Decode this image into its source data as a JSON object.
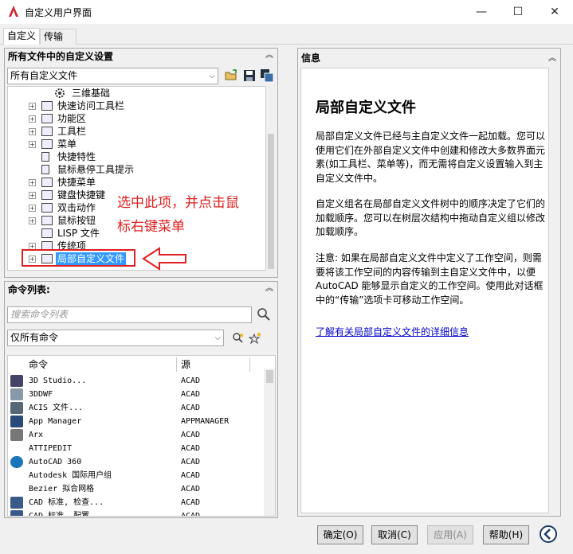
{
  "window": {
    "title": "自定义用户界面",
    "min_glyph": "—",
    "max_glyph": "☐",
    "close_glyph": "✕"
  },
  "tabs": [
    "自定义",
    "传输"
  ],
  "left_panel": {
    "title": "所有文件中的自定义设置",
    "filter_value": "所有自定义文件",
    "tree_items": [
      {
        "label": "三维基础"
      },
      {
        "label": "快速访问工具栏"
      },
      {
        "label": "功能区"
      },
      {
        "label": "工具栏"
      },
      {
        "label": "菜单"
      },
      {
        "label": "快捷特性"
      },
      {
        "label": "鼠标悬停工具提示"
      },
      {
        "label": "快捷菜单"
      },
      {
        "label": "键盘快捷键"
      },
      {
        "label": "双击动作"
      },
      {
        "label": "鼠标按钮"
      },
      {
        "label": "LISP 文件"
      },
      {
        "label": "传统项"
      },
      {
        "label": "局部自定义文件"
      }
    ]
  },
  "annotation": {
    "line1": "选中此项，并点击鼠",
    "line2": "标右键菜单",
    "color": "#e02020"
  },
  "command_panel": {
    "title": "命令列表:",
    "search_placeholder": "搜索命令列表",
    "filter_value": "仅所有命令",
    "col_command": "命令",
    "col_source": "源",
    "rows": [
      {
        "name": "3D Studio...",
        "source": "ACAD"
      },
      {
        "name": "3DDWF",
        "source": "ACAD"
      },
      {
        "name": "ACIS 文件...",
        "source": "ACAD"
      },
      {
        "name": "App Manager",
        "source": "APPMANAGER"
      },
      {
        "name": "Arx",
        "source": "ACAD"
      },
      {
        "name": "ATTIPEDIT",
        "source": "ACAD"
      },
      {
        "name": "AutoCAD 360",
        "source": "ACAD"
      },
      {
        "name": "Autodesk 国际用户组",
        "source": "ACAD"
      },
      {
        "name": "Bezier 拟合网格",
        "source": "ACAD"
      },
      {
        "name": "CAD 标准, 检查...",
        "source": "ACAD"
      },
      {
        "name": "CAD 标准, 配置...",
        "source": "ACAD"
      }
    ]
  },
  "info_panel": {
    "title": "信息",
    "heading": "局部自定义文件",
    "para1": "局部自定义文件已经与主自定义文件一起加载。您可以使用它们在外部自定义文件中创建和修改大多数界面元素(如工具栏、菜单等)，而无需将自定义设置输入到主自定义文件中。",
    "para2": "自定义组名在局部自定义文件树中的顺序决定了它们的加载顺序。您可以在树层次结构中拖动自定义组以修改加载顺序。",
    "para3": "注意: 如果在局部自定义文件中定义了工作空间，则需要将该工作空间的内容传输到主自定义文件中，以便 AutoCAD 能够显示自定义的工作空间。使用此对话框中的“传输”选项卡可移动工作空间。",
    "link": "了解有关局部自定义文件的详细信息"
  },
  "buttons": {
    "ok": "确定(O)",
    "cancel": "取消(C)",
    "apply": "应用(A)",
    "help": "帮助(H)"
  }
}
